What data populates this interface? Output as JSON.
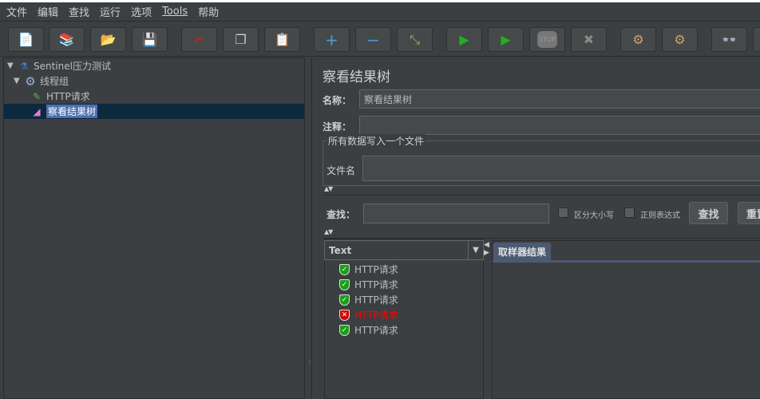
{
  "menu": [
    "文件",
    "编辑",
    "查找",
    "运行",
    "选项",
    "Tools",
    "帮助"
  ],
  "toolbar": [
    {
      "name": "new-icon",
      "glyph": "📄"
    },
    {
      "name": "templates-icon",
      "glyph": "📚"
    },
    {
      "name": "open-icon",
      "glyph": "📂"
    },
    {
      "name": "save-icon",
      "glyph": "💾"
    },
    {
      "name": "cut-icon",
      "glyph": "✂"
    },
    {
      "name": "copy-icon",
      "glyph": "❐"
    },
    {
      "name": "paste-icon",
      "glyph": "📋"
    },
    {
      "name": "expand-icon",
      "glyph": "+"
    },
    {
      "name": "collapse-icon",
      "glyph": "−"
    },
    {
      "name": "toggle-icon",
      "glyph": "⤡"
    },
    {
      "name": "start-icon",
      "glyph": "▶"
    },
    {
      "name": "start-no-timers-icon",
      "glyph": "▶"
    },
    {
      "name": "stop-icon",
      "glyph": "STOP"
    },
    {
      "name": "shutdown-icon",
      "glyph": "✖"
    },
    {
      "name": "clear-icon",
      "glyph": "⚙"
    },
    {
      "name": "clear-all-icon",
      "glyph": "⚙"
    },
    {
      "name": "search-binoculars-icon",
      "glyph": "👓"
    }
  ],
  "tree": {
    "root": "Sentinel压力测试",
    "group": "线程组",
    "sampler": "HTTP请求",
    "listener": "察看结果树"
  },
  "panel": {
    "title": "察看结果树",
    "name_label": "名称：",
    "name_value": "察看结果树",
    "comment_label": "注释：",
    "comment_value": "",
    "file_group": "所有数据写入一个文件",
    "filename_label": "文件名",
    "filename_value": "",
    "search_label": "查找：",
    "search_value": "",
    "case_label": "区分大小写",
    "regex_label": "正则表达式",
    "search_button": "查找",
    "reset_button": "重置",
    "renderer": "Text",
    "results": [
      {
        "label": "HTTP请求",
        "status": "success"
      },
      {
        "label": "HTTP请求",
        "status": "success"
      },
      {
        "label": "HTTP请求",
        "status": "success"
      },
      {
        "label": "HTTP请求",
        "status": "error"
      },
      {
        "label": "HTTP请求",
        "status": "success"
      }
    ],
    "tab": "取样器结果"
  },
  "colors": {
    "success": "#1a9e1a",
    "error": "#d00000",
    "error_text": "#ff0000",
    "selection": "#4b6eaf"
  }
}
